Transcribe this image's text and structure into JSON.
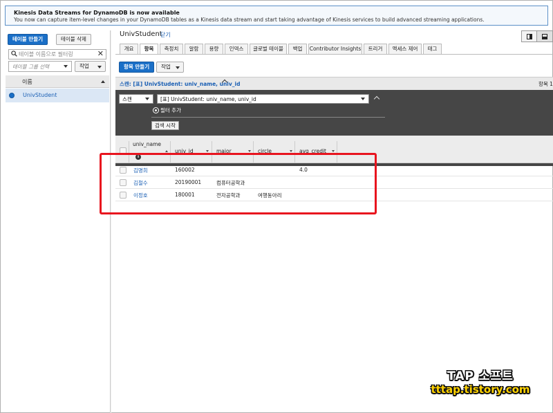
{
  "banner": {
    "title": "Kinesis Data Streams for DynamoDB is now available",
    "description": "You now can capture item-level changes in your DynamoDB tables as a Kinesis data stream and start taking advantage of Kinesis services to build advanced streaming applications."
  },
  "sidebar": {
    "create_table_label": "테이블 만들기",
    "delete_table_label": "테이블 삭제",
    "search_placeholder": "테이블 이름으로 필터링",
    "group_placeholder": "테이블 그룹 선택",
    "actions_label": "작업",
    "column_header": "이름",
    "tables": [
      {
        "name": "UnivStudent",
        "selected": true
      }
    ]
  },
  "main": {
    "table_name": "UnivStudent",
    "close_label": "닫기",
    "tabs": [
      {
        "label": "개요",
        "active": false
      },
      {
        "label": "항목",
        "active": true
      },
      {
        "label": "측정치",
        "active": false
      },
      {
        "label": "알람",
        "active": false
      },
      {
        "label": "용량",
        "active": false
      },
      {
        "label": "인덱스",
        "active": false
      },
      {
        "label": "글로벌 테이블",
        "active": false
      },
      {
        "label": "백업",
        "active": false
      },
      {
        "label": "Contributor Insights",
        "active": false
      },
      {
        "label": "트리거",
        "active": false
      },
      {
        "label": "액세스 제어",
        "active": false
      },
      {
        "label": "태그",
        "active": false
      }
    ],
    "create_item_label": "항목 만들기",
    "actions_label": "작업",
    "scan_summary": "스캔: [표] UnivStudent: univ_name, univ_id",
    "items_count_label": "항목 1",
    "query_mode": "스캔",
    "index_value": "[표] UnivStudent: univ_name, univ_id",
    "add_filter_label": "필터 추가",
    "start_search_label": "검색 시작",
    "columns": [
      "univ_name",
      "univ_id",
      "major",
      "circle",
      "avg_credit"
    ],
    "rows": [
      {
        "univ_name": "김명희",
        "univ_id": "160002",
        "major": "",
        "circle": "",
        "avg_credit": "4.0"
      },
      {
        "univ_name": "김철수",
        "univ_id": "20190001",
        "major": "컴퓨터공학과",
        "circle": "",
        "avg_credit": ""
      },
      {
        "univ_name": "이정호",
        "univ_id": "180001",
        "major": "전자공학과",
        "circle": "여행동아리",
        "avg_credit": ""
      }
    ]
  },
  "watermark": {
    "line1": "TAP 소프트",
    "line2": "tttap.tistory.com"
  },
  "colors": {
    "accent": "#1a6fc7",
    "highlight_box": "#e8141e",
    "panel_dark": "#464646"
  }
}
